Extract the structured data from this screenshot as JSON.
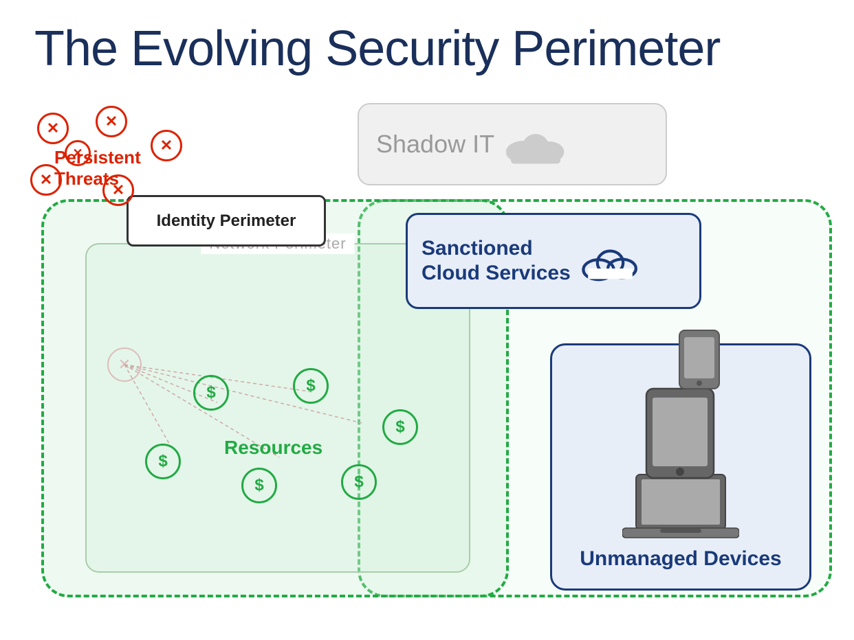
{
  "title": "The Evolving Security Perimeter",
  "labels": {
    "shadow_it": "Shadow IT",
    "sanctioned_cloud": "Sanctioned\nCloud Services",
    "network_perimeter": "Network Perimeter",
    "identity_perimeter": "Identity Perimeter",
    "persistent_threats": "Persistent\nThreats",
    "resources": "Resources",
    "unmanaged_devices": "Unmanaged\nDevices"
  },
  "colors": {
    "title": "#1a2f5a",
    "green_border": "#22aa44",
    "green_fill": "rgba(200,240,210,0.3)",
    "red": "#dd2200",
    "dark_blue": "#1a3a7a",
    "gray": "#999999",
    "light_gray_bg": "#f0f0f0"
  }
}
